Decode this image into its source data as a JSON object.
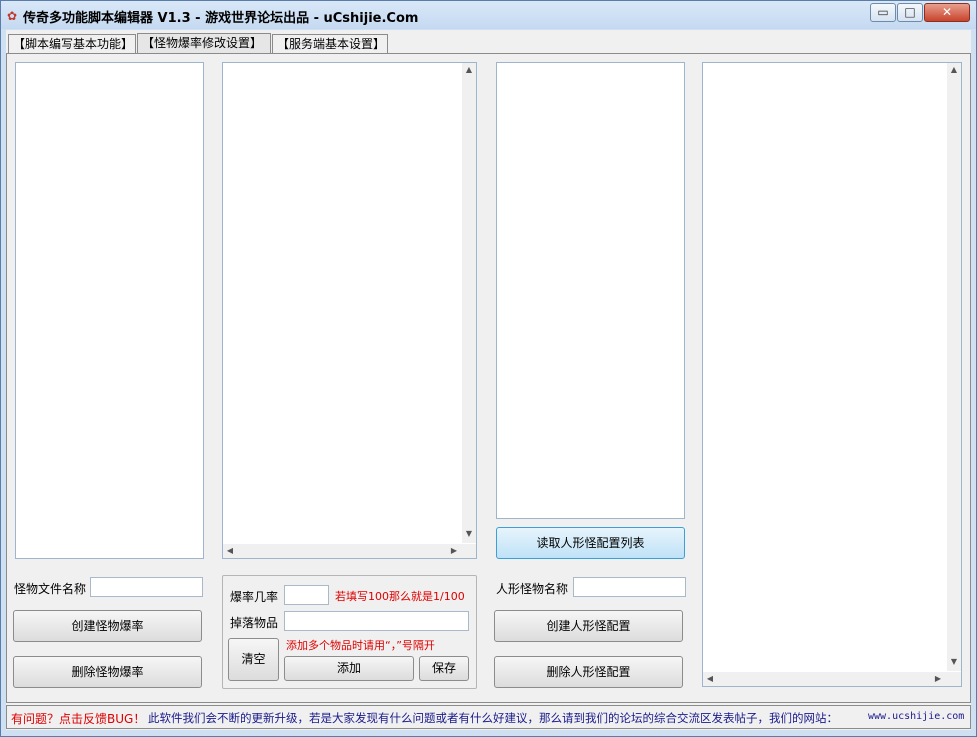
{
  "window": {
    "title": "传奇多功能脚本编辑器 V1.3 - 游戏世界论坛出品 - uCshijie.Com",
    "minimize_glyph": "▭",
    "maximize_glyph": "□",
    "close_glyph": "✕"
  },
  "tabs": [
    {
      "label": "【脚本编写基本功能】"
    },
    {
      "label": "【怪物爆率修改设置】"
    },
    {
      "label": "【服务端基本设置】"
    }
  ],
  "left": {
    "monster_file_label": "怪物文件名称",
    "monster_file_value": "",
    "create_button": "创建怪物爆率",
    "delete_button": "删除怪物爆率"
  },
  "middle": {
    "rate_label": "爆率几率",
    "rate_value": "",
    "rate_hint": "若填写100那么就是1/100",
    "drop_label": "掉落物品",
    "drop_value": "",
    "drop_hint": "添加多个物品时请用“，”号隔开",
    "clear_button": "清空",
    "add_button": "添加",
    "save_button": "保存"
  },
  "right": {
    "read_button": "读取人形怪配置列表",
    "humanoid_name_label": "人形怪物名称",
    "humanoid_name_value": "",
    "create_button": "创建人形怪配置",
    "delete_button": "删除人形怪配置"
  },
  "status": {
    "feedback": "有问题？点击反馈BUG！",
    "message": "此软件我们会不断的更新升级，若是大家发现有什么问题或者有什么好建议，那么请到我们的论坛的综合交流区发表帖子，我们的网站：",
    "website": "www.ucshijie.com"
  },
  "colors": {
    "title_bar": "#cfe0f3",
    "hint_red": "#e00000",
    "status_blue": "#1a1a8c",
    "accent_blue_button": "#bfe2f7"
  }
}
